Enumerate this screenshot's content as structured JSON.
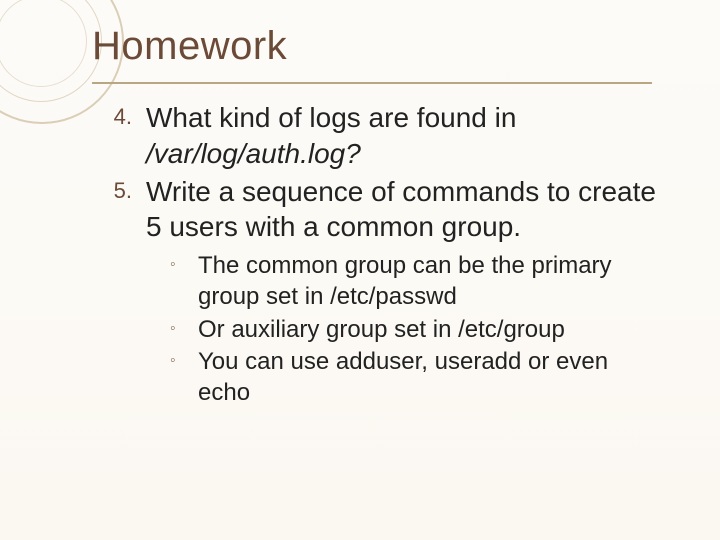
{
  "slide": {
    "title": "Homework",
    "items": [
      {
        "number": "4.",
        "text_a": "What kind of logs are found in ",
        "text_b": "/var/log/auth.log",
        "text_c": "?"
      },
      {
        "number": "5.",
        "text_a": "Write a sequence of commands to create 5 users with a common group.",
        "text_b": "",
        "text_c": ""
      }
    ],
    "subitems": [
      {
        "bullet": "◦",
        "text": "The common group can be the primary group set in /etc/passwd"
      },
      {
        "bullet": "◦",
        "text": "Or auxiliary group set in /etc/group"
      },
      {
        "bullet": "◦",
        "text": "You can use adduser, useradd or even echo"
      }
    ]
  }
}
